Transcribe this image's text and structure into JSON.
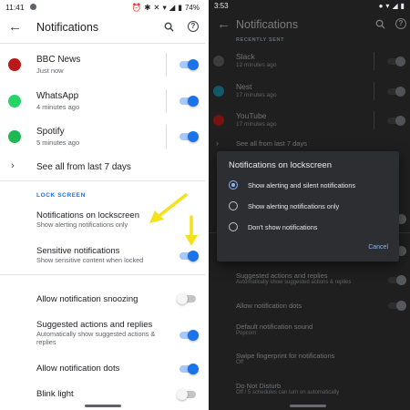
{
  "left": {
    "status": {
      "time": "11:41",
      "battery": "74%"
    },
    "appbar": {
      "title": "Notifications"
    },
    "apps": [
      {
        "name": "BBC News",
        "time": "Just now",
        "color": "#bb1919",
        "icon": "bbc-news-icon",
        "enabled": true
      },
      {
        "name": "WhatsApp",
        "time": "4 minutes ago",
        "color": "#25d366",
        "icon": "whatsapp-icon",
        "enabled": true
      },
      {
        "name": "Spotify",
        "time": "5 minutes ago",
        "color": "#1db954",
        "icon": "spotify-icon",
        "enabled": true
      }
    ],
    "see_all": "See all from last 7 days",
    "section": "LOCK SCREEN",
    "lockscreen": {
      "title": "Notifications on lockscreen",
      "subtitle": "Show alerting notifications only"
    },
    "sensitive": {
      "title": "Sensitive notifications",
      "subtitle": "Show sensitive content when locked",
      "enabled": true
    },
    "snooze": {
      "title": "Allow notification snoozing",
      "enabled": false
    },
    "suggested": {
      "title": "Suggested actions and replies",
      "subtitle": "Automatically show suggested actions & replies",
      "enabled": true
    },
    "dots": {
      "title": "Allow notification dots",
      "enabled": true
    },
    "blink": {
      "title": "Blink light",
      "enabled": false
    },
    "accent": "#1a73e8",
    "arrow_color": "#f5e11b"
  },
  "right": {
    "status": {
      "time": "3:53"
    },
    "appbar": {
      "title": "Notifications"
    },
    "section": "RECENTLY SENT",
    "apps": [
      {
        "name": "Slack",
        "time": "12 minutes ago",
        "color": "#6b6b6b",
        "icon": "slack-icon"
      },
      {
        "name": "Nest",
        "time": "17 minutes ago",
        "color": "#00afd8",
        "icon": "nest-icon"
      },
      {
        "name": "YouTube",
        "time": "17 minutes ago",
        "color": "#ff0000",
        "icon": "youtube-icon"
      }
    ],
    "see_all": "See all from last 7 days",
    "dialog": {
      "title": "Notifications on lockscreen",
      "options": [
        "Show alerting and silent notifications",
        "Show alerting notifications only",
        "Don't show notifications"
      ],
      "selected": 0,
      "cancel": "Cancel"
    },
    "suggested": {
      "title": "Suggested actions and replies",
      "subtitle": "Automatically show suggested actions & replies"
    },
    "dots": {
      "title": "Allow notification dots"
    },
    "sound": {
      "title": "Default notification sound",
      "subtitle": "Popcorn"
    },
    "swipe": {
      "title": "Swipe fingerprint for notifications",
      "subtitle": "Off"
    },
    "dnd": {
      "title": "Do Not Disturb",
      "subtitle": "Off / 5 schedules can turn on automatically"
    }
  }
}
